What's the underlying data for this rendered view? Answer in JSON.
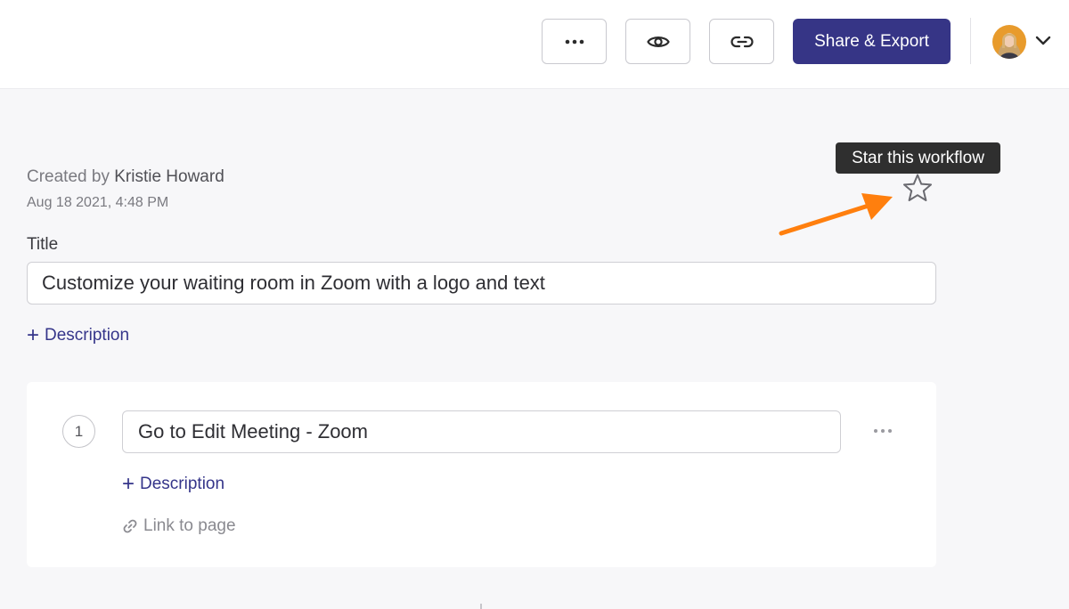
{
  "header": {
    "actions": {
      "more_icon": "more-horizontal-icon",
      "preview_icon": "eye-icon",
      "link_icon": "link-icon"
    },
    "share_label": "Share & Export",
    "account_chevron_icon": "chevron-down-icon"
  },
  "meta": {
    "created_prefix": "Created by",
    "author": "Kristie Howard",
    "date": "Aug 18 2021, 4:48 PM"
  },
  "star": {
    "tooltip": "Star this workflow",
    "icon": "star-outline-icon"
  },
  "annotation": {
    "arrow_color": "#ff7f0e"
  },
  "workflow": {
    "title_label": "Title",
    "title_value": "Customize your waiting room in Zoom with a logo and text",
    "description_label": "Description"
  },
  "steps": [
    {
      "number": "1",
      "title": "Go to Edit Meeting - Zoom",
      "description_label": "Description",
      "link_label": "Link to page"
    }
  ],
  "colors": {
    "primary": "#363586",
    "background": "#f7f7f9",
    "tooltip_bg": "#2f2f2f"
  }
}
